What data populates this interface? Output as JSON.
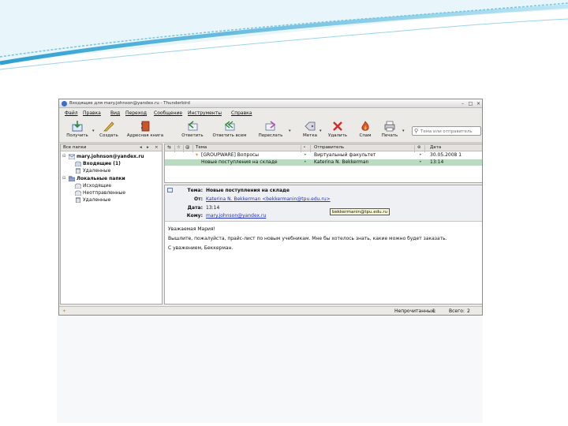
{
  "window": {
    "title": "Входящие для mary.johnson@yandex.ru - Thunderbird",
    "buttons": {
      "minimize": "–",
      "maximize": "□",
      "close": "×"
    }
  },
  "menu": [
    "Файл",
    "Правка",
    "Вид",
    "Переход",
    "Сообщение",
    "Инструменты",
    "Справка"
  ],
  "toolbar": {
    "get": "Получить",
    "write": "Создать",
    "address_book": "Адресная книга",
    "reply": "Ответить",
    "reply_all": "Ответить всем",
    "forward": "Переслать",
    "tag": "Метка",
    "delete": "Удалить",
    "junk": "Спам",
    "print": "Печать",
    "search_placeholder": "Тема или отправитель"
  },
  "folders": {
    "header": "Все папки",
    "nav_prev": "◂",
    "nav_next": "▸",
    "nav_close": "×",
    "account": "mary.johnson@yandex.ru",
    "inbox": "Входящие (1)",
    "trash": "Удаленные",
    "local": "Локальные папки",
    "outbox": "Исходящие",
    "unsent": "Неотправленные",
    "local_trash": "Удаленные"
  },
  "message_list": {
    "headers": {
      "thread": "⇆",
      "star": "☆",
      "attach": "@",
      "subject": "Тема",
      "read": "∘",
      "sender": "Отправитель",
      "junk": "⊚",
      "date": "Дата"
    },
    "rows": [
      {
        "flag": "✶",
        "subject": "[GROUPWARE] Вопросы",
        "read": "•",
        "sender": "Виртуальный факультет",
        "status": "•",
        "date": "30.05.2008 1"
      },
      {
        "flag": "",
        "subject": "Новые поступления на складе",
        "read": "•",
        "sender": "Katerina N. Bekkerman",
        "status": "•",
        "date": "13:14"
      }
    ]
  },
  "preview": {
    "subject_label": "Тема:",
    "subject": "Новые поступления на складе",
    "from_label": "От:",
    "from": "Katerina N. Bekkerman <bekkermanin@tpu.edu.ru>",
    "date_label": "Дата:",
    "date": "13:14",
    "to_label": "Кому:",
    "to": "mary.johnson@yandex.ru",
    "tooltip": "bekkermanin@tpu.edu.ru",
    "greeting": "Уважаемая Мария!",
    "body": "Вышлите, пожалуйста, прайс-лист по новым учебникам. Мне бы хотелось знать, какие можно будет заказать.",
    "signature": "С уважением, Беккерман."
  },
  "status": {
    "unread_label": "Непрочитанных:",
    "unread": "1",
    "total_label": "Всего:",
    "total": "2"
  },
  "colors": {
    "selected_row": "#b9dcc0",
    "link": "#2233bb",
    "slide_accent": "#47b3d8"
  }
}
